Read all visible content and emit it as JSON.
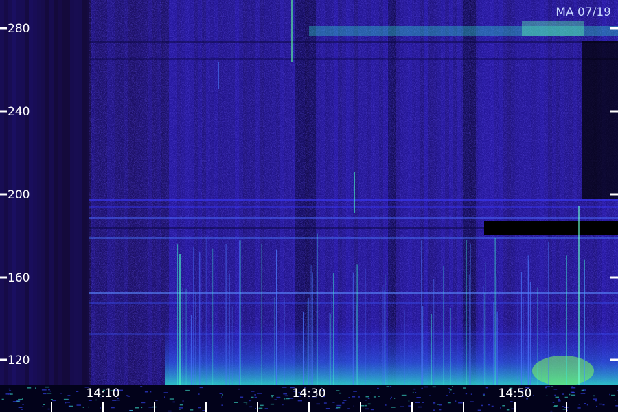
{
  "chart_data": {
    "type": "heatmap",
    "title": "",
    "corner_label": "MA 07/19",
    "xlabel": "",
    "ylabel": "",
    "x_ticks": [
      "14:10",
      "14:30",
      "14:50"
    ],
    "y_ticks": [
      "120",
      "160",
      "200",
      "240",
      "280"
    ],
    "grid": false,
    "legend": "none",
    "colors": {
      "background": "#000000",
      "low": "#1a0a6e",
      "mid": "#2a2af0",
      "high": "#2ee6c8",
      "peak": "#7dff5a",
      "tick": "#ffffff",
      "label_text": "#ffffff"
    }
  }
}
